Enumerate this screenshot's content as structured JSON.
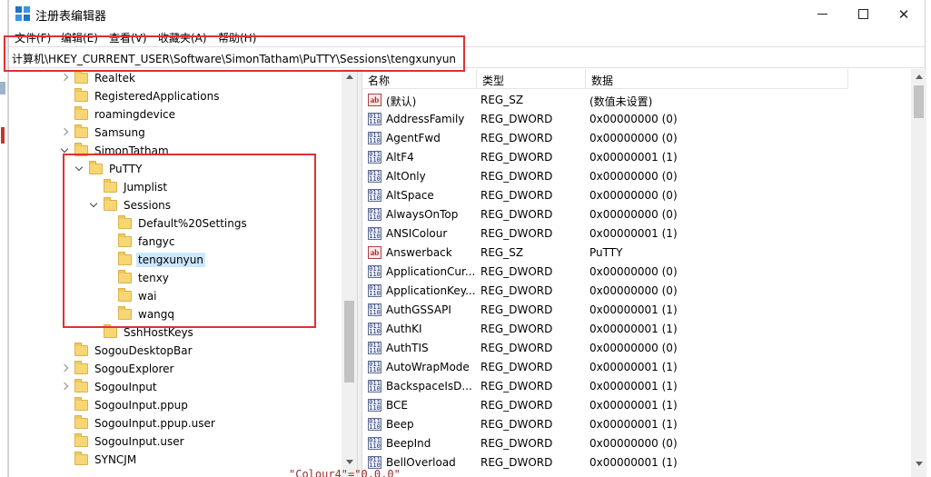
{
  "window": {
    "title": "注册表编辑器",
    "controls": {
      "minimize": "—",
      "maximize": "☐",
      "close": "✕"
    }
  },
  "menu": [
    "文件(F)",
    "编辑(E)",
    "查看(V)",
    "收藏夹(A)",
    "帮助(H)"
  ],
  "address": "计算机\\HKEY_CURRENT_USER\\Software\\SimonTatham\\PuTTY\\Sessions\\tengxunyun",
  "tree": {
    "items": [
      {
        "label": "Realtek",
        "state": "collapsed"
      },
      {
        "label": "RegisteredApplications",
        "state": "none"
      },
      {
        "label": "roamingdevice",
        "state": "none"
      },
      {
        "label": "Samsung",
        "state": "collapsed"
      },
      {
        "label": "SimonTatham",
        "state": "expanded"
      },
      {
        "label": "PuTTY",
        "state": "expanded"
      },
      {
        "label": "Jumplist",
        "state": "none"
      },
      {
        "label": "Sessions",
        "state": "expanded"
      },
      {
        "label": "Default%20Settings",
        "state": "none"
      },
      {
        "label": "fangyc",
        "state": "none"
      },
      {
        "label": "tengxunyun",
        "state": "none",
        "selected": true
      },
      {
        "label": "tenxy",
        "state": "none"
      },
      {
        "label": "wai",
        "state": "none"
      },
      {
        "label": "wangq",
        "state": "none"
      },
      {
        "label": "SshHostKeys",
        "state": "none"
      },
      {
        "label": "SogouDesktopBar",
        "state": "none"
      },
      {
        "label": "SogouExplorer",
        "state": "collapsed"
      },
      {
        "label": "SogouInput",
        "state": "collapsed"
      },
      {
        "label": "SogouInput.ppup",
        "state": "none"
      },
      {
        "label": "SogouInput.ppup.user",
        "state": "none"
      },
      {
        "label": "SogouInput.user",
        "state": "none"
      },
      {
        "label": "SYNCJM",
        "state": "none"
      }
    ]
  },
  "values": {
    "headers": {
      "name": "名称",
      "type": "类型",
      "data": "数据"
    },
    "rows": [
      {
        "icon": "ab",
        "name": "(默认)",
        "type": "REG_SZ",
        "data": "(数值未设置)"
      },
      {
        "icon": "dword",
        "name": "AddressFamily",
        "type": "REG_DWORD",
        "data": "0x00000000 (0)"
      },
      {
        "icon": "dword",
        "name": "AgentFwd",
        "type": "REG_DWORD",
        "data": "0x00000000 (0)"
      },
      {
        "icon": "dword",
        "name": "AltF4",
        "type": "REG_DWORD",
        "data": "0x00000001 (1)"
      },
      {
        "icon": "dword",
        "name": "AltOnly",
        "type": "REG_DWORD",
        "data": "0x00000000 (0)"
      },
      {
        "icon": "dword",
        "name": "AltSpace",
        "type": "REG_DWORD",
        "data": "0x00000000 (0)"
      },
      {
        "icon": "dword",
        "name": "AlwaysOnTop",
        "type": "REG_DWORD",
        "data": "0x00000000 (0)"
      },
      {
        "icon": "dword",
        "name": "ANSIColour",
        "type": "REG_DWORD",
        "data": "0x00000001 (1)"
      },
      {
        "icon": "ab",
        "name": "Answerback",
        "type": "REG_SZ",
        "data": "PuTTY"
      },
      {
        "icon": "dword",
        "name": "ApplicationCur...",
        "type": "REG_DWORD",
        "data": "0x00000000 (0)"
      },
      {
        "icon": "dword",
        "name": "ApplicationKey...",
        "type": "REG_DWORD",
        "data": "0x00000000 (0)"
      },
      {
        "icon": "dword",
        "name": "AuthGSSAPI",
        "type": "REG_DWORD",
        "data": "0x00000001 (1)"
      },
      {
        "icon": "dword",
        "name": "AuthKI",
        "type": "REG_DWORD",
        "data": "0x00000001 (1)"
      },
      {
        "icon": "dword",
        "name": "AuthTIS",
        "type": "REG_DWORD",
        "data": "0x00000000 (0)"
      },
      {
        "icon": "dword",
        "name": "AutoWrapMode",
        "type": "REG_DWORD",
        "data": "0x00000001 (1)"
      },
      {
        "icon": "dword",
        "name": "BackspaceIsD...",
        "type": "REG_DWORD",
        "data": "0x00000001 (1)"
      },
      {
        "icon": "dword",
        "name": "BCE",
        "type": "REG_DWORD",
        "data": "0x00000001 (1)"
      },
      {
        "icon": "dword",
        "name": "Beep",
        "type": "REG_DWORD",
        "data": "0x00000001 (1)"
      },
      {
        "icon": "dword",
        "name": "BeepInd",
        "type": "REG_DWORD",
        "data": "0x00000000 (0)"
      },
      {
        "icon": "dword",
        "name": "BellOverload",
        "type": "REG_DWORD",
        "data": "0x00000001 (1)"
      }
    ]
  },
  "background_text": "\"Colour4\"=\"0,0,0\"",
  "colors": {
    "highlight_box": "#e0312f",
    "selection": "#cce8ff",
    "folder": "#f7d674"
  }
}
